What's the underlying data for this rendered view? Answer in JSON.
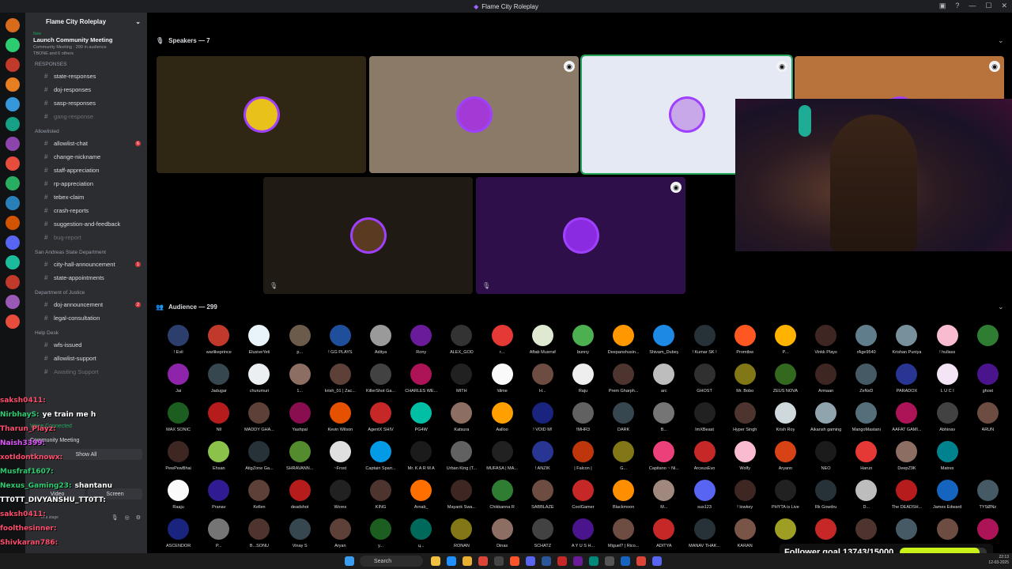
{
  "window": {
    "title": "Flame City Roleplay"
  },
  "server": {
    "name": "Flame City Roleplay"
  },
  "event": {
    "label": "Launch Community Meeting",
    "sub": "Community Meeting · 299 in audience",
    "others": "TBONE and 6 others",
    "live_tag": "Now"
  },
  "categories": [
    {
      "name": "RESPONSES",
      "channels": [
        {
          "label": "state-responses",
          "muted": false,
          "badge": ""
        },
        {
          "label": "doj-responses",
          "muted": false,
          "badge": ""
        },
        {
          "label": "sasp-responses",
          "muted": false,
          "badge": ""
        },
        {
          "label": "gang-response",
          "muted": true,
          "badge": ""
        }
      ]
    },
    {
      "name": "Allowlisted",
      "channels": [
        {
          "label": "allowlist-chat",
          "muted": false,
          "badge": "6"
        },
        {
          "label": "change-nickname",
          "muted": false,
          "badge": ""
        },
        {
          "label": "staff-appreciation",
          "muted": false,
          "badge": ""
        },
        {
          "label": "rp-appreciation",
          "muted": false,
          "badge": ""
        },
        {
          "label": "tebex-claim",
          "muted": false,
          "badge": ""
        },
        {
          "label": "crash-reports",
          "muted": false,
          "badge": ""
        },
        {
          "label": "suggestion-and-feedback",
          "muted": false,
          "badge": ""
        },
        {
          "label": "bug-report",
          "muted": true,
          "badge": ""
        }
      ]
    },
    {
      "name": "San Andreas State Department",
      "channels": [
        {
          "label": "city-hall-announcement",
          "muted": false,
          "badge": "1"
        },
        {
          "label": "state-appointments",
          "muted": false,
          "badge": ""
        }
      ]
    },
    {
      "name": "Department of Justice",
      "channels": [
        {
          "label": "doj-announcement",
          "muted": false,
          "badge": "2"
        },
        {
          "label": "legal-consultation",
          "muted": false,
          "badge": ""
        }
      ]
    },
    {
      "name": "Help Desk",
      "channels": [
        {
          "label": "wfs-issued",
          "muted": false,
          "badge": ""
        },
        {
          "label": "allowlist-support",
          "muted": false,
          "badge": ""
        },
        {
          "label": "Awaiting Support",
          "muted": true,
          "badge": ""
        }
      ]
    }
  ],
  "voice": {
    "status": "Voice Connected",
    "channel": "Community Meeting",
    "show_all": "Show All",
    "video": "Video",
    "screen": "Screen"
  },
  "speakers": {
    "label": "Speakers — 7"
  },
  "audience": {
    "label": "Audience — 299"
  },
  "speaker_tiles": [
    {
      "bg": "#2f2713",
      "av": "#e8c21a",
      "sfx": false
    },
    {
      "bg": "#8b7a68",
      "av": "#a33ad6",
      "sfx": true
    },
    {
      "bg": "#e4e9f3",
      "av": "#c8a8e8",
      "sfx": true
    },
    {
      "bg": "#b8733c",
      "av": "#b8733c",
      "sfx": true
    },
    {
      "bg": "#201a14",
      "av": "#5a3a20",
      "sfx": false
    },
    {
      "bg": "#2f0f4a",
      "av": "#8a2be2",
      "sfx": true
    }
  ],
  "audience_members": [
    {
      "n": "! Evil",
      "c": "#2c3e6b"
    },
    {
      "n": "warlikeprince",
      "c": "#c0392b"
    },
    {
      "n": "ElusiveYeti",
      "c": "#e8f4fa"
    },
    {
      "n": "p...",
      "c": "#6b5b4b"
    },
    {
      "n": "! GG PLAYS",
      "c": "#1f4e9a"
    },
    {
      "n": "Aditya",
      "c": "#9a9a9a"
    },
    {
      "n": "Rony",
      "c": "#6a1b9a"
    },
    {
      "n": "ALEX_GOD",
      "c": "#333"
    },
    {
      "n": "r...",
      "c": "#e53935"
    },
    {
      "n": "Aftab Musrraf",
      "c": "#dfe8d0"
    },
    {
      "n": "bunny",
      "c": "#4caf50"
    },
    {
      "n": "Deepanshusin...",
      "c": "#ff9800"
    },
    {
      "n": "Shivam_Dubey",
      "c": "#1e88e5"
    },
    {
      "n": "! Kumar SK !",
      "c": "#263238"
    },
    {
      "n": "Promtbw",
      "c": "#ff5722"
    },
    {
      "n": "P...",
      "c": "#ffb300"
    },
    {
      "n": "Vinkk Plays",
      "c": "#3e2723"
    },
    {
      "n": "rAge9540",
      "c": "#607d8b"
    },
    {
      "n": "Krishan Puniya",
      "c": "#78909c"
    },
    {
      "n": "! hullass",
      "c": "#f8bbd0"
    },
    {
      "n": "",
      "c": "#2e7d32"
    },
    {
      "n": "Jai",
      "c": "#8e24aa"
    },
    {
      "n": "Jadugar",
      "c": "#37474f"
    },
    {
      "n": "churumuri",
      "c": "#eceff1"
    },
    {
      "n": "1...",
      "c": "#8d6e63"
    },
    {
      "n": "krish_01 | Zac...",
      "c": "#5d4037"
    },
    {
      "n": "KillerShot Ga...",
      "c": "#424242"
    },
    {
      "n": "CHARLES WE...",
      "c": "#ad1457"
    },
    {
      "n": "MITH",
      "c": "#212121"
    },
    {
      "n": "!dime",
      "c": "#fafafa"
    },
    {
      "n": "H...",
      "c": "#6d4c41"
    },
    {
      "n": "Raju",
      "c": "#eeeeee"
    },
    {
      "n": "Prem Gharph...",
      "c": "#4e342e"
    },
    {
      "n": "arc",
      "c": "#bdbdbd"
    },
    {
      "n": "GHOST",
      "c": "#303030"
    },
    {
      "n": "Mr. Bobo",
      "c": "#827717"
    },
    {
      "n": "ZEUS NOVA",
      "c": "#33691e"
    },
    {
      "n": "Armaan",
      "c": "#3e2723"
    },
    {
      "n": "ZeNxD",
      "c": "#455a64"
    },
    {
      "n": "PARADOX",
      "c": "#283593"
    },
    {
      "n": "L U C I",
      "c": "#f3e5f5"
    },
    {
      "n": "ghost",
      "c": "#4a148c"
    },
    {
      "n": "MAX SONIC",
      "c": "#1b5e20"
    },
    {
      "n": "Nll",
      "c": "#b71c1c"
    },
    {
      "n": "MADDY GHA...",
      "c": "#5d4037"
    },
    {
      "n": "Yashpal",
      "c": "#880e4f"
    },
    {
      "n": "Kevin Wilson",
      "c": "#e65100"
    },
    {
      "n": "AgentX SHIV",
      "c": "#c62828"
    },
    {
      "n": "PG4W",
      "c": "#00bfa5"
    },
    {
      "n": "Katsura",
      "c": "#8d6e63"
    },
    {
      "n": "Aalloo",
      "c": "#ffa000"
    },
    {
      "n": "! VOID M!",
      "c": "#1a237e"
    },
    {
      "n": "!MHR3",
      "c": "#616161"
    },
    {
      "n": "DARK",
      "c": "#37474f"
    },
    {
      "n": "B...",
      "c": "#757575"
    },
    {
      "n": "ImXBeast",
      "c": "#212121"
    },
    {
      "n": "Hyper Singh",
      "c": "#4e342e"
    },
    {
      "n": "Krish Roy",
      "c": "#cfd8dc"
    },
    {
      "n": "Aikansh gaming",
      "c": "#90a4ae"
    },
    {
      "n": "MangoMastani",
      "c": "#546e7a"
    },
    {
      "n": "AAFAT GAMI...",
      "c": "#ad1457"
    },
    {
      "n": "Abhinav",
      "c": "#424242"
    },
    {
      "n": "ARUN",
      "c": "#6d4c41"
    },
    {
      "n": "PewPewBhai",
      "c": "#3e2723"
    },
    {
      "n": "Ehsan",
      "c": "#8bc34a"
    },
    {
      "n": "AtigZone Ga...",
      "c": "#263238"
    },
    {
      "n": "SHRAVANN...",
      "c": "#558b2f"
    },
    {
      "n": "~Frost",
      "c": "#e0e0e0"
    },
    {
      "n": "Captain Sparr...",
      "c": "#039be5"
    },
    {
      "n": "Mr. K A R M A",
      "c": "#1b1b1b"
    },
    {
      "n": "Urban King (T...",
      "c": "#616161"
    },
    {
      "n": "MUFASA | MA...",
      "c": "#212121"
    },
    {
      "n": "! ANZIK",
      "c": "#283593"
    },
    {
      "n": "| Falcon |",
      "c": "#bf360c"
    },
    {
      "n": "G...",
      "c": "#827717"
    },
    {
      "n": "Capitano ~ Ni...",
      "c": "#ec407a"
    },
    {
      "n": "ArceusEvo",
      "c": "#c62828"
    },
    {
      "n": "Wolfy",
      "c": "#f8bbd0"
    },
    {
      "n": "Aryann",
      "c": "#d84315"
    },
    {
      "n": "NEO",
      "c": "#1b1b1b"
    },
    {
      "n": "Harun",
      "c": "#e53935"
    },
    {
      "n": "DeepZ9K",
      "c": "#8d6e63"
    },
    {
      "n": "Matrex",
      "c": "#00838f"
    },
    {
      "n": "",
      "c": "#000"
    },
    {
      "n": "Raaju",
      "c": "#fafafa"
    },
    {
      "n": "Pranav",
      "c": "#311b92"
    },
    {
      "n": "Kellen",
      "c": "#5d4037"
    },
    {
      "n": "deadshot",
      "c": "#b71c1c"
    },
    {
      "n": "Wores",
      "c": "#212121"
    },
    {
      "n": "KING",
      "c": "#4e342e"
    },
    {
      "n": "Arnab_",
      "c": "#ff6f00"
    },
    {
      "n": "Mayank Swa...",
      "c": "#3e2723"
    },
    {
      "n": "Chikkanna R",
      "c": "#2e7d32"
    },
    {
      "n": "SABBLAZE",
      "c": "#6d4c41"
    },
    {
      "n": "CoolGamer",
      "c": "#c62828"
    },
    {
      "n": "Blackmoon",
      "c": "#ff8f00"
    },
    {
      "n": "M...",
      "c": "#a1887f"
    },
    {
      "n": "sus123",
      "c": "#5865f2"
    },
    {
      "n": "! lowkey",
      "c": "#3e2723"
    },
    {
      "n": "PHYTA is Live",
      "c": "#212121"
    },
    {
      "n": "Rk Gowdru",
      "c": "#263238"
    },
    {
      "n": "D...",
      "c": "#bdbdbd"
    },
    {
      "n": "The DEADSH...",
      "c": "#b71c1c"
    },
    {
      "n": "James Edward",
      "c": "#1565c0"
    },
    {
      "n": "TYSØNz",
      "c": "#455a64"
    },
    {
      "n": "ASCENDOR",
      "c": "#1a237e"
    },
    {
      "n": "P...",
      "c": "#757575"
    },
    {
      "n": "B...SONU",
      "c": "#4e342e"
    },
    {
      "n": "Vinay S",
      "c": "#37474f"
    },
    {
      "n": "Aryan",
      "c": "#5d4037"
    },
    {
      "n": "y...",
      "c": "#1b5e20"
    },
    {
      "n": "ц...",
      "c": "#00695c"
    },
    {
      "n": "RONAN",
      "c": "#827717"
    },
    {
      "n": "Dinas",
      "c": "#8d6e63"
    },
    {
      "n": "SCHATZ",
      "c": "#424242"
    },
    {
      "n": "A Y U S H...",
      "c": "#4a148c"
    },
    {
      "n": "Miguel? | Rico...",
      "c": "#6d4c41"
    },
    {
      "n": "ADITYA",
      "c": "#c62828"
    },
    {
      "n": "MANAV THAK...",
      "c": "#263238"
    },
    {
      "n": "KARAN",
      "c": "#795548"
    },
    {
      "n": "",
      "c": "#9e9d24"
    },
    {
      "n": "",
      "c": "#c62828"
    },
    {
      "n": "",
      "c": "#4e342e"
    },
    {
      "n": "",
      "c": "#455a64"
    },
    {
      "n": "",
      "c": "#6d4c41"
    },
    {
      "n": "",
      "c": "#ad1457"
    }
  ],
  "chat": [
    {
      "user": "saksh0411:",
      "text": "",
      "color": "#ff4d6d"
    },
    {
      "user": "NirbhayS:",
      "text": "ye train me h",
      "color": "#2ecc71"
    },
    {
      "user": "Tharun_Playz:",
      "text": "",
      "color": "#ff4d6d"
    },
    {
      "user": "Naish3399:",
      "text": "",
      "color": "#e056fd"
    },
    {
      "user": "xotIdontknowx:",
      "text": "",
      "color": "#ff4d6d"
    },
    {
      "user": "Musfraf1607:",
      "text": "",
      "color": "#2ecc71"
    },
    {
      "user": "Nexus_Gaming23:",
      "text": "shantanu",
      "color": "#2ecc71"
    },
    {
      "user": "TT0TT_DIVYANSHU_TT0TT:",
      "text": "",
      "color": "#ffffff"
    },
    {
      "user": "saksh0411:",
      "text": "",
      "color": "#ff4d6d"
    },
    {
      "user": "foolthesinner:",
      "text": "",
      "color": "#ff4d6d"
    },
    {
      "user": "Shivkaran786:",
      "text": "",
      "color": "#ff4d6d"
    }
  ],
  "follower_goal": {
    "label": "Follower goal 13743/15000",
    "fraction": 0.916
  },
  "taskbar": {
    "search": "Search",
    "time": "22:13",
    "date": "12-03-2025"
  },
  "user": {
    "name": "Shantanu",
    "status": "In a stage"
  }
}
